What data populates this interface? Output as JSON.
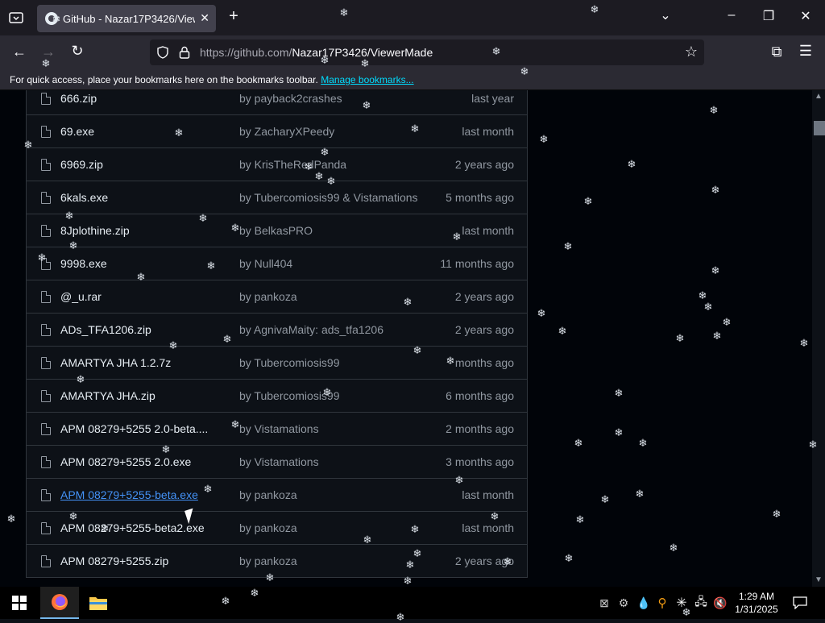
{
  "browser": {
    "tab_title": "GitHub - Nazar17P3426/ViewerMade",
    "url_prefix": "https://github.com/",
    "url_path": "Nazar17P3426/ViewerMade",
    "bookmarks_text": "For quick access, place your bookmarks here on the bookmarks toolbar.",
    "bookmarks_link": "Manage bookmarks..."
  },
  "files": [
    {
      "name": "666.zip",
      "by": "by payback2crashes",
      "date": "last year"
    },
    {
      "name": "69.exe",
      "by": "by ZacharyXPeedy",
      "date": "last month"
    },
    {
      "name": "6969.zip",
      "by": "by KrisTheRedPanda",
      "date": "2 years ago"
    },
    {
      "name": "6kals.exe",
      "by": "by Tubercomiosis99 & Vistamations",
      "date": "5 months ago"
    },
    {
      "name": "8Jplothine.zip",
      "by": "by BelkasPRO",
      "date": "last month"
    },
    {
      "name": "9998.exe",
      "by": "by Null404",
      "date": "11 months ago"
    },
    {
      "name": "@_u.rar",
      "by": "by pankoza",
      "date": "2 years ago"
    },
    {
      "name": "ADs_TFA1206.zip",
      "by": "by AgnivaMaity: ads_tfa1206",
      "date": "2 years ago"
    },
    {
      "name": "AMARTYA JHA 1.2.7z",
      "by": "by Tubercomiosis99",
      "date": "months ago"
    },
    {
      "name": "AMARTYA JHA.zip",
      "by": "by Tubercomiosis99",
      "date": "6 months ago"
    },
    {
      "name": "APM 08279+5255 2.0-beta....",
      "by": "by Vistamations",
      "date": "2 months ago"
    },
    {
      "name": "APM 08279+5255 2.0.exe",
      "by": "by Vistamations",
      "date": "3 months ago"
    },
    {
      "name": "APM 08279+5255-beta.exe",
      "by": "by pankoza",
      "date": "last month",
      "hover": true
    },
    {
      "name": "APM 08279+5255-beta2.exe",
      "by": "by pankoza",
      "date": "last month"
    },
    {
      "name": "APM 08279+5255.zip",
      "by": "by pankoza",
      "date": "2 years ago"
    }
  ],
  "taskbar": {
    "time": "1:29 AM",
    "date": "1/31/2025",
    "start_icon": "windows-logo-icon",
    "pinned": [
      "firefox-icon",
      "file-explorer-icon"
    ]
  },
  "colors": {
    "page_bg": "#0d1117",
    "link": "#4493f8",
    "text_muted": "#9198a1",
    "border": "#30363d"
  }
}
